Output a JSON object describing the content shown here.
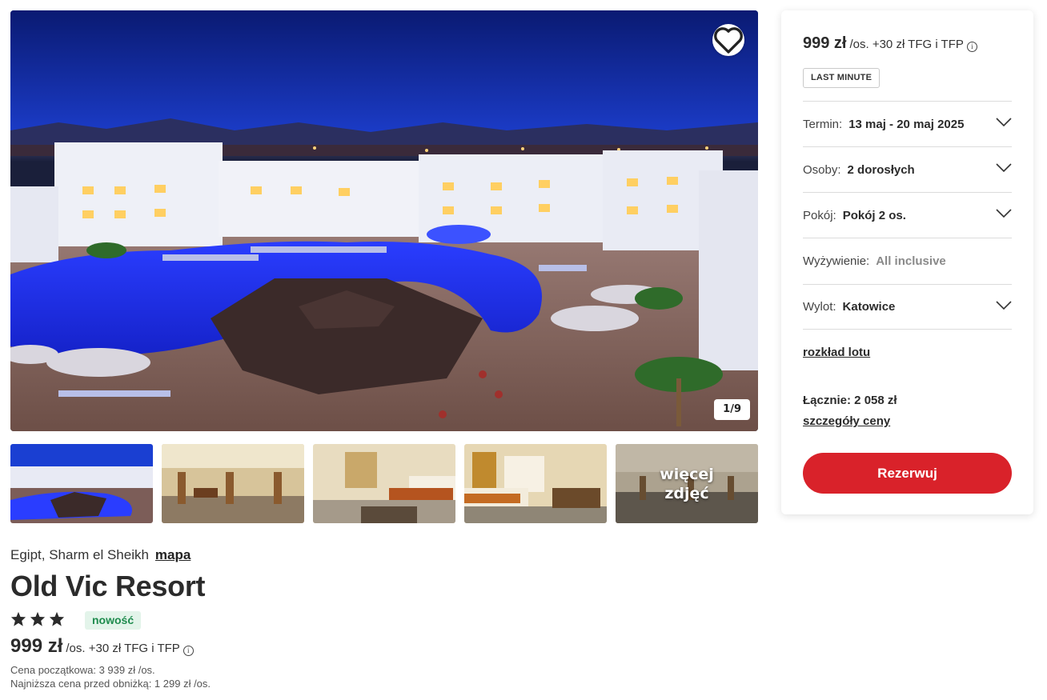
{
  "gallery": {
    "counter": "1/9",
    "more_photos_label": "więcej\nzdjęć",
    "favorite_icon": "heart-outline-icon"
  },
  "hotel": {
    "location": "Egipt, Sharm el Sheikh",
    "map_link": "mapa",
    "name": "Old Vic Resort",
    "stars": 3,
    "badge": "nowość",
    "price": "999 zł",
    "price_suffix": "/os. +30 zł TFG i TFP",
    "original_price": "Cena początkowa: 3 939 zł /os.",
    "lowest_price": "Najniższa cena przed obniżką: 1 299 zł /os."
  },
  "booking": {
    "price": "999 zł",
    "price_suffix": "/os. +30 zł TFG i TFP",
    "badge": "LAST MINUTE",
    "rows": [
      {
        "label": "Termin:",
        "value": "13 maj - 20 maj 2025"
      },
      {
        "label": "Osoby:",
        "value": "2 dorosłych"
      },
      {
        "label": "Pokój:",
        "value": "Pokój 2 os."
      },
      {
        "label": "Wyżywienie:",
        "value": "All inclusive"
      },
      {
        "label": "Wylot:",
        "value": "Katowice"
      }
    ],
    "flight_schedule_link": "rozkład lotu",
    "total": "Łącznie: 2 058 zł",
    "price_details_link": "szczegóły ceny",
    "book_button": "Rezerwuj"
  },
  "colors": {
    "accent_red": "#d9222a",
    "badge_green_bg": "#e3f4ea",
    "badge_green_text": "#1f8c4e"
  }
}
